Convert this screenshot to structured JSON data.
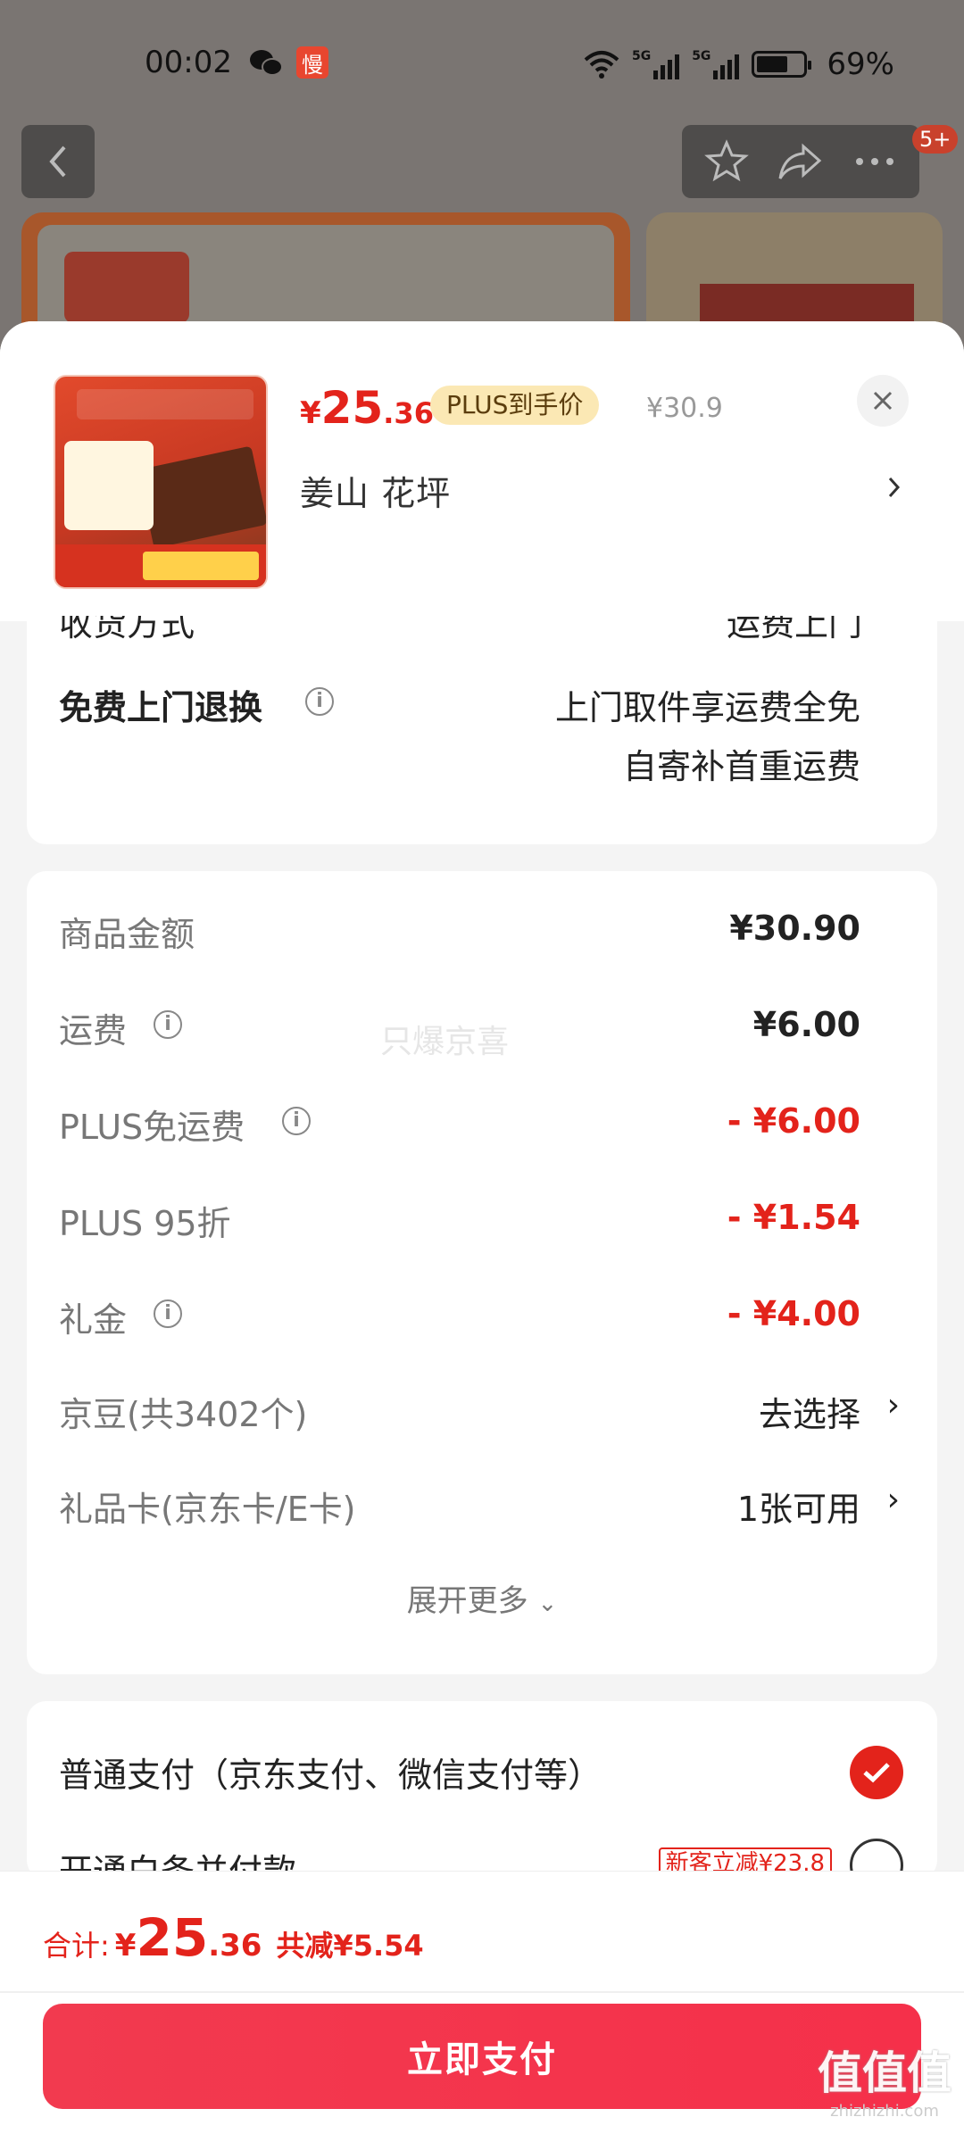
{
  "status_bar": {
    "time": "00:02",
    "slow_badge": "慢",
    "signal1": "5G",
    "signal2": "5G",
    "battery": "69%"
  },
  "nav": {
    "badge": "5+"
  },
  "product": {
    "price_yen": "¥",
    "price_int": "25",
    "price_dec": ".36",
    "plus_tag": "PLUS到手价",
    "original_price": "¥30.9",
    "spec": "姜山  花坪"
  },
  "shipping": {
    "clipped_label": "收货方式",
    "clipped_value": "运费上门",
    "return_label": "免费上门退换",
    "return_line1": "上门取件享运费全免",
    "return_line2": "自寄补首重运费"
  },
  "costs": {
    "watermark": "只爆京喜",
    "rows": [
      {
        "label": "商品金额",
        "value": "¥30.90"
      },
      {
        "label": "运费",
        "value": "¥6.00"
      },
      {
        "label": "PLUS免运费",
        "value": "- ¥6.00"
      },
      {
        "label": "PLUS 95折",
        "value": "- ¥1.54"
      },
      {
        "label": "礼金",
        "value": "- ¥4.00"
      },
      {
        "label": "京豆(共3402个)",
        "value": "去选择"
      },
      {
        "label": "礼品卡(京东卡/E卡)",
        "value": "1张可用"
      }
    ],
    "expand_more": "展开更多"
  },
  "payment": {
    "normal_label": "普通支付（京东支付、微信支付等）",
    "baitiao_label": "开通白条并付款",
    "baitiao_tag": "新客立减¥23.8"
  },
  "footer": {
    "total_label": "合计:",
    "total_yen": "¥",
    "total_int": "25",
    "total_dec": ".36",
    "saved": "共减¥5.54",
    "pay_button": "立即支付",
    "watermark_big": "值值值",
    "watermark_small": "zhizhizhi.com"
  },
  "colors": {
    "accent_red": "#e3231b",
    "pay_button": "#f23a4f",
    "plus_tag_bg": "#fbe8b4"
  }
}
